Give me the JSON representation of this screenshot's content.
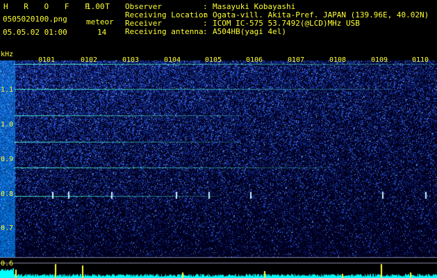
{
  "header": {
    "app_name": "H R O F F T",
    "version": "1.00",
    "filename": "0505020100.png",
    "timestamp": "05.05.02 01:00",
    "count_label": "meteor",
    "count_value": "14"
  },
  "station": {
    "rows": [
      {
        "label": "Observer",
        "value": "Masayuki Kobayashi"
      },
      {
        "label": "Receiving Location",
        "value": "Ogata-vill. Akita-Pref. JAPAN (139.96E, 40.02N)"
      },
      {
        "label": "Receiver",
        "value": "ICOM IC-575 53.7492(@LCD)MHz USB"
      },
      {
        "label": "Receiving antenna",
        "value": "A504HB(yagi 4el)"
      }
    ]
  },
  "spectrogram": {
    "y_unit": "kHz",
    "y_labels": [
      "1.1",
      "1.0",
      "0.9",
      "0.8",
      "0.7",
      "0.6"
    ],
    "time_ticks": [
      "0101",
      "0102",
      "0103",
      "0104",
      "0105",
      "0106",
      "0107",
      "0108",
      "0109",
      "0110"
    ],
    "colors": {
      "text": "#ffff33",
      "background": "#000000",
      "noise": "#1a3cff",
      "line": "#4fffd0",
      "trace": "#00ffff"
    }
  }
}
